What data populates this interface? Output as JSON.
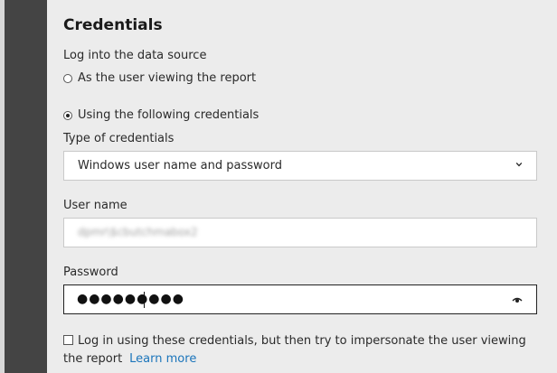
{
  "section": {
    "title": "Credentials",
    "login_label": "Log into the data source"
  },
  "login_options": [
    {
      "label": "As the user viewing the report",
      "selected": false
    },
    {
      "label": "Using the following credentials",
      "selected": true
    }
  ],
  "credential_type": {
    "label": "Type of credentials",
    "value": "Windows user name and password",
    "icon": "chevron-down-icon"
  },
  "username": {
    "label": "User name",
    "value": "dpmr\\$cbutchmabox2"
  },
  "password": {
    "label": "Password",
    "value": "●●●●●●●●●",
    "icon": "eye-icon"
  },
  "impersonate": {
    "checked": false,
    "label": "Log in using these credentials, but then try to impersonate the user viewing the report",
    "link": "Learn more"
  },
  "colors": {
    "sidebar": "#444444",
    "panel": "#ececec",
    "link": "#1b75bb"
  }
}
